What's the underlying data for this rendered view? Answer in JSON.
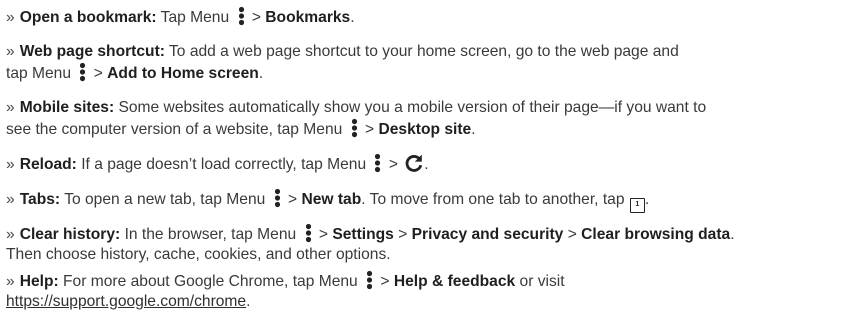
{
  "bullet": "»",
  "sep": ">",
  "items": {
    "bookmark": {
      "label": "Open a bookmark:",
      "text1": "Tap Menu",
      "target": "Bookmarks",
      "end": "."
    },
    "shortcut": {
      "label": "Web page shortcut:",
      "text1": "To add a web page shortcut to your home screen, go to the web page and",
      "text2": "tap Menu",
      "target": "Add to Home screen",
      "end": "."
    },
    "mobile": {
      "label": "Mobile sites:",
      "text1": "Some websites automatically show you a mobile version of their page—if you want to",
      "text2": "see the computer version of a website, tap Menu",
      "target": "Desktop site",
      "end": "."
    },
    "reload": {
      "label": "Reload:",
      "text1": "If a page doesn’t load correctly, tap Menu",
      "icon": "reload-icon",
      "end": "."
    },
    "tabs": {
      "label": "Tabs:",
      "text1": "To open a new tab, tap Menu",
      "target": "New tab",
      "text2": ". To move from one tab to another, tap",
      "tab_count": "1",
      "end": "."
    },
    "history": {
      "label": "Clear history:",
      "text1": "In the browser, tap Menu",
      "path1": "Settings",
      "path2": "Privacy and security",
      "path3": "Clear browsing data",
      "end": ".",
      "text2": "Then choose history, cache, cookies, and other options."
    },
    "help": {
      "label": "Help:",
      "text1": "For more about Google Chrome, tap Menu",
      "target": "Help & feedback",
      "text2": "or visit",
      "link": "https://support.google.com/chrome",
      "end": "."
    }
  },
  "icons": {
    "menu": "more-vert-icon",
    "reload": "reload-icon",
    "tab_switcher": "tab-switcher-icon"
  },
  "colors": {
    "text": "#3a3a3a",
    "bold": "#1f1f1f",
    "icon": "#222222"
  }
}
